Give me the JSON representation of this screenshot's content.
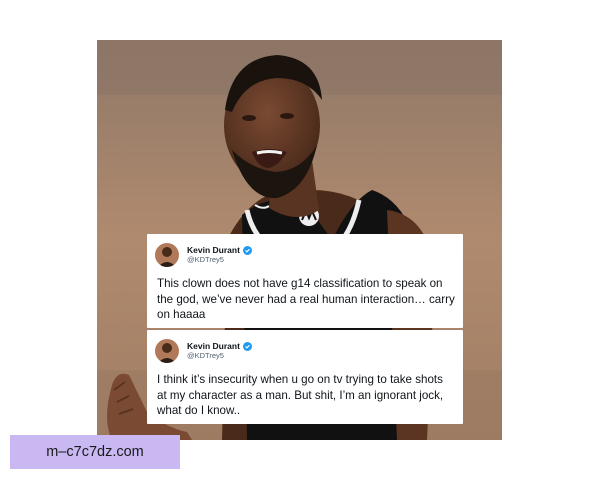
{
  "tweets": [
    {
      "name": "Kevin Durant",
      "handle": "@KDTrey5",
      "text": "This clown does not have g14 classification to speak on the god, we’ve never had a real human interaction… carry on haaaa"
    },
    {
      "name": "Kevin Durant",
      "handle": "@KDTrey5",
      "text": "I think it’s insecurity when u go on tv trying to take shots at my character as a man. But shit, I’m an ignorant jock, what do I know.."
    }
  ],
  "watermark": {
    "text": "m–c7c7dz.com",
    "background": "#c9b8f2"
  },
  "colors": {
    "verified": "#1d9bf0",
    "jersey": "#111111",
    "court": "#b08a6e"
  }
}
